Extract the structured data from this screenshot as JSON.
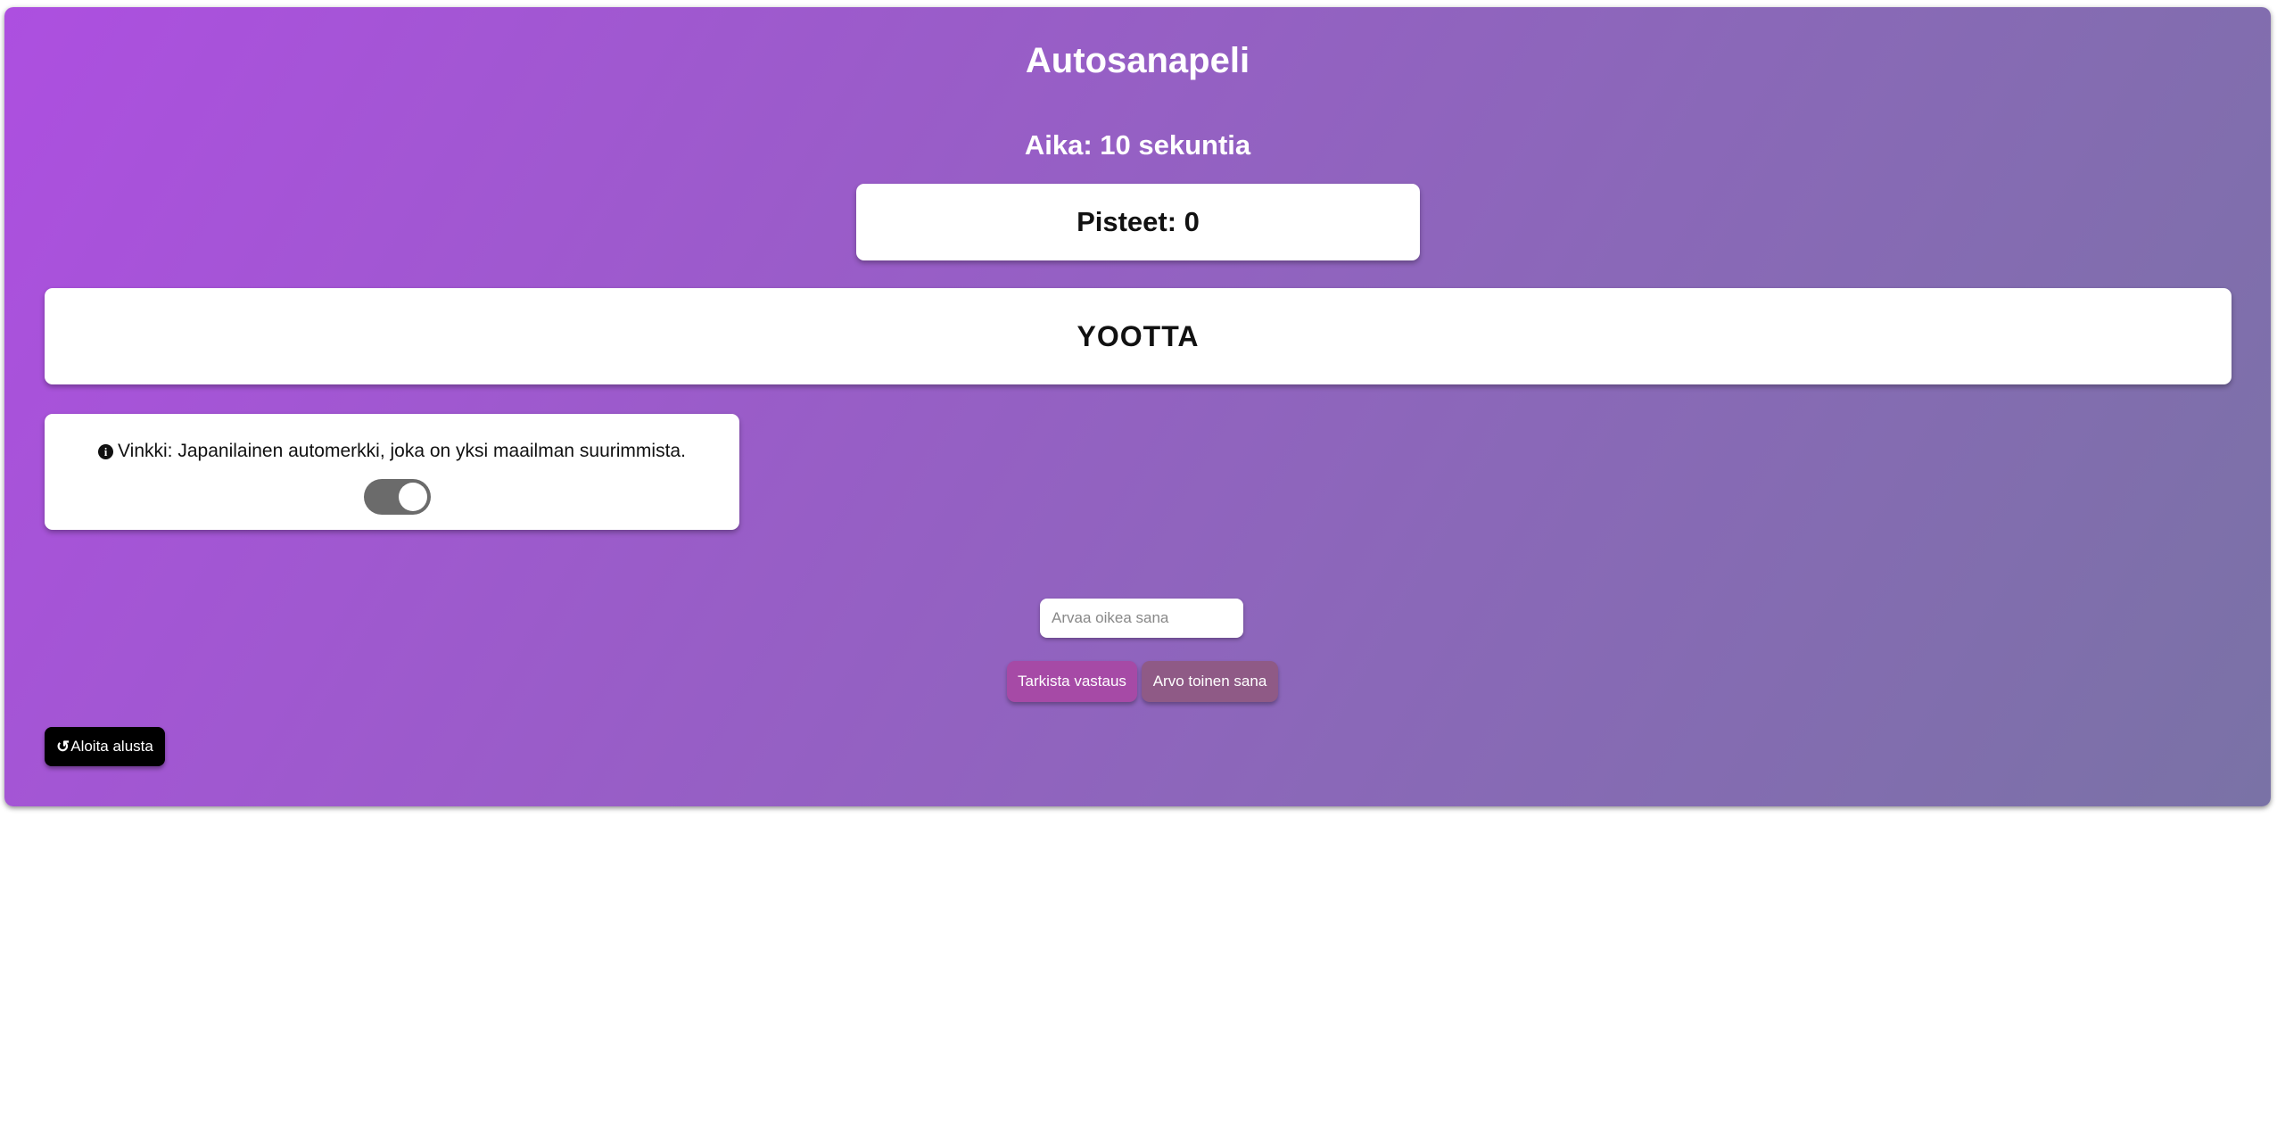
{
  "game": {
    "title": "Autosanapeli",
    "timer_label": "Aika: 10 sekuntia",
    "score_label": "Pisteet: 0",
    "scrambled_word": "YOOTTA",
    "hint": {
      "text": "Vinkki: Japanilainen automerkki, joka on yksi maailman suurimmista.",
      "icon": "info-circle-icon",
      "toggle_on": true
    },
    "guess_input": {
      "value": "",
      "placeholder": "Arvaa oikea sana"
    },
    "buttons": {
      "check": "Tarkista vastaus",
      "new_word": "Arvo toinen sana",
      "restart": "Aloita alusta",
      "restart_icon": "restart-icon"
    }
  },
  "colors": {
    "gradient_start": "#ad4fe0",
    "gradient_end": "#7a72a6",
    "check_button": "#a64aa6",
    "new_word_button": "#8f5a86",
    "restart_button": "#000000",
    "toggle_track": "#6b6b6b"
  }
}
